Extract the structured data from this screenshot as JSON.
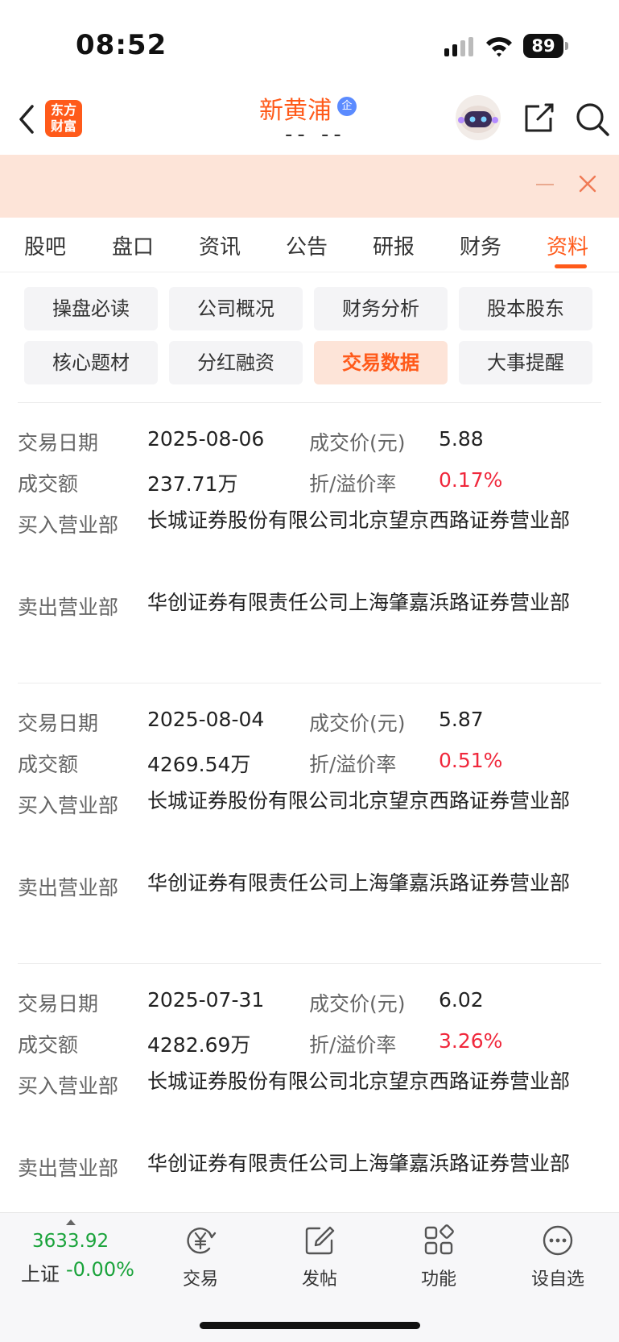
{
  "status_bar": {
    "time": "08:52",
    "battery": "89"
  },
  "nav": {
    "logo_line1": "东方",
    "logo_line2": "财富",
    "title": "新黄浦",
    "badge": "企",
    "subtitle": "-- --"
  },
  "tabs": [
    "股吧",
    "盘口",
    "资讯",
    "公告",
    "研报",
    "财务",
    "资料"
  ],
  "active_tab": "资料",
  "subtabs": [
    "操盘必读",
    "公司概况",
    "财务分析",
    "股本股东",
    "核心题材",
    "分红融资",
    "交易数据",
    "大事提醒"
  ],
  "active_subtab": "交易数据",
  "labels": {
    "date": "交易日期",
    "price": "成交价(元)",
    "amount": "成交额",
    "premium": "折/溢价率",
    "buyer": "买入营业部",
    "seller": "卖出营业部"
  },
  "records": [
    {
      "date": "2025-08-06",
      "price": "5.88",
      "amount": "237.71万",
      "premium": "0.17%",
      "buyer": "长城证券股份有限公司北京望京西路证券营业部",
      "seller": "华创证券有限责任公司上海肇嘉浜路证券营业部"
    },
    {
      "date": "2025-08-04",
      "price": "5.87",
      "amount": "4269.54万",
      "premium": "0.51%",
      "buyer": "长城证券股份有限公司北京望京西路证券营业部",
      "seller": "华创证券有限责任公司上海肇嘉浜路证券营业部"
    },
    {
      "date": "2025-07-31",
      "price": "6.02",
      "amount": "4282.69万",
      "premium": "3.26%",
      "buyer": "长城证券股份有限公司北京望京西路证券营业部",
      "seller": "华创证券有限责任公司上海肇嘉浜路证券营业部"
    }
  ],
  "bottom_bar": {
    "index_value": "3633.92",
    "index_name": "上证",
    "index_change": "-0.00%",
    "items": [
      "交易",
      "发帖",
      "功能",
      "设自选"
    ]
  },
  "colors": {
    "accent": "#ff5a1a",
    "up_red": "#f0283c",
    "down_green": "#1aa33b",
    "banner_bg": "#fde4d8"
  }
}
